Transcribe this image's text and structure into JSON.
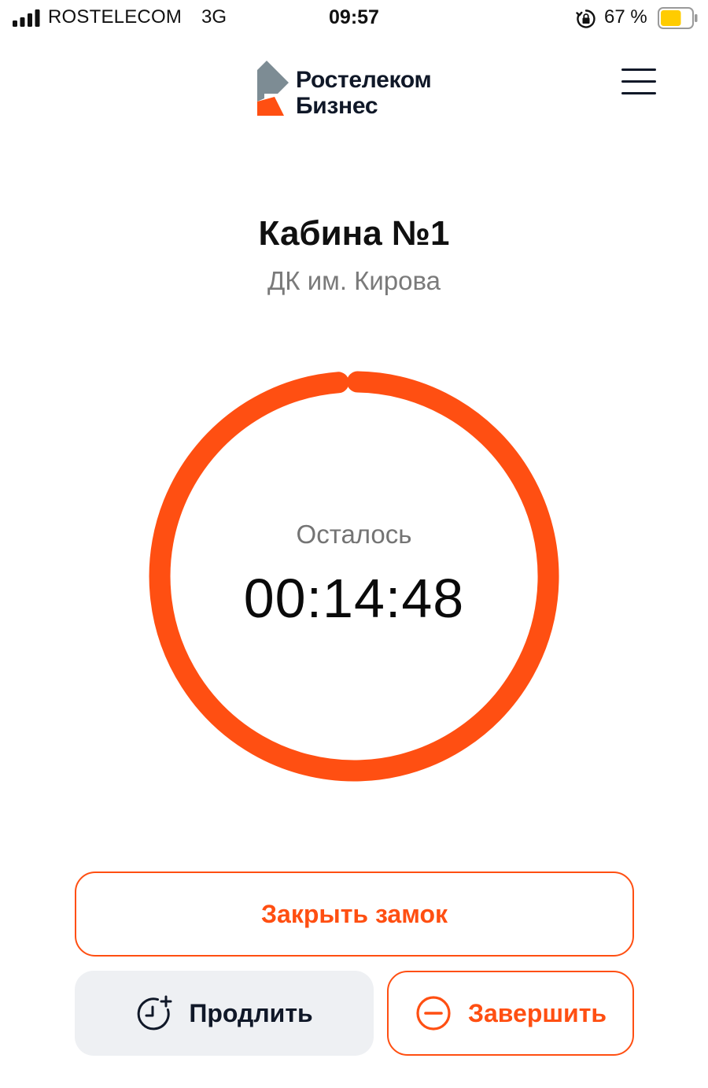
{
  "status_bar": {
    "carrier": "ROSTELECOM",
    "network": "3G",
    "time": "09:57",
    "battery_percent": "67 %",
    "battery_level": 0.67,
    "battery_color": "#ffcc00"
  },
  "header": {
    "logo_line1": "Ростелеком",
    "logo_line2": "Бизнес",
    "menu_icon": "hamburger-menu-icon"
  },
  "cabin": {
    "title": "Кабина №1",
    "location": "ДК им. Кирова"
  },
  "timer": {
    "label": "Осталось",
    "value": "00:14:48",
    "progress": 0.99,
    "color": "#ff4f12"
  },
  "actions": {
    "lock_label": "Закрыть замок",
    "extend_label": "Продлить",
    "extend_icon": "clock-plus-icon",
    "finish_label": "Завершить",
    "finish_icon": "minus-circle-icon"
  },
  "colors": {
    "accent": "#ff4f12",
    "logo_gray": "#7d8c94",
    "dark_text": "#101828",
    "secondary_button_bg": "#eef0f3"
  }
}
